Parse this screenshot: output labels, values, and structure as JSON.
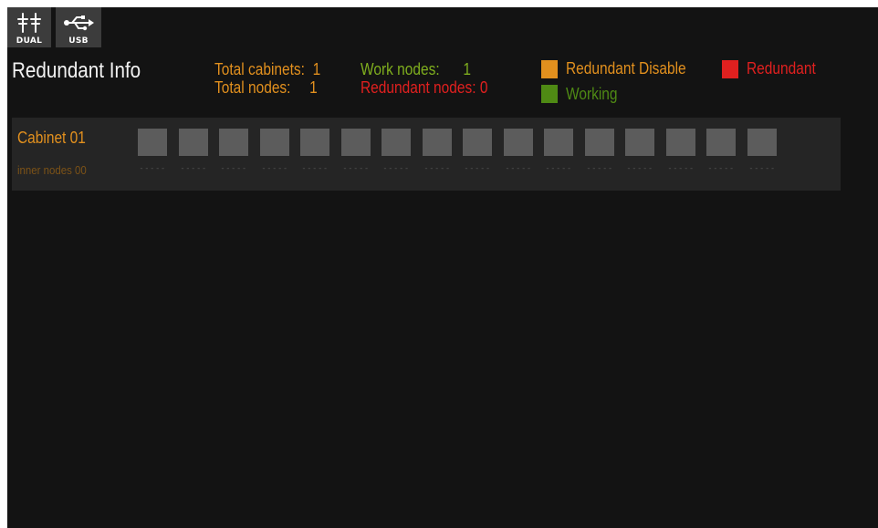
{
  "toolbar": {
    "dual_label": "DUAL",
    "usb_label": "USB"
  },
  "page": {
    "title": "Redundant Info"
  },
  "stats": {
    "total_cabinets_label": "Total cabinets:",
    "total_cabinets_value": "1",
    "total_nodes_label": "Total nodes:",
    "total_nodes_value": "1",
    "work_nodes_label": "Work nodes:",
    "work_nodes_value": "1",
    "redundant_nodes_label": "Redundant nodes:",
    "redundant_nodes_value": "0"
  },
  "legend": {
    "redundant_disable": {
      "label": "Redundant Disable",
      "color": "#e2901e"
    },
    "redundant": {
      "label": "Redundant",
      "color": "#e0201f"
    },
    "working": {
      "label": "Working",
      "color": "#4f8a14"
    }
  },
  "cabinets": [
    {
      "name": "Cabinet 01",
      "inner_label": "inner nodes 00",
      "node_color": "#5c5c5c",
      "nodes": [
        "-----",
        "-----",
        "-----",
        "-----",
        "-----",
        "-----",
        "-----",
        "-----",
        "-----",
        "-----",
        "-----",
        "-----",
        "-----",
        "-----",
        "-----",
        "-----"
      ]
    }
  ]
}
